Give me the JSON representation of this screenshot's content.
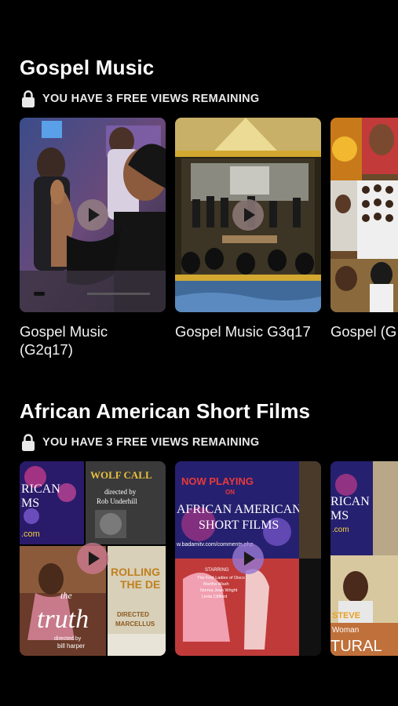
{
  "sections": [
    {
      "title": "Gospel Music",
      "views_notice": "YOU HAVE 3 FREE VIEWS REMAINING",
      "cards": [
        {
          "title_line1": "Gospel Music",
          "title_line2": "(G2q17)"
        },
        {
          "title_line1": "Gospel Music G3q17",
          "title_line2": ""
        },
        {
          "title_line1": "Gospel (G",
          "title_line2": ""
        }
      ]
    },
    {
      "title": "African American Short Films",
      "views_notice": "YOU HAVE 3 FREE VIEWS REMAINING",
      "cards": [
        {
          "poster_text": {
            "wolf_call": "WOLF CALL",
            "directed_by": "directed by",
            "director": "Rob Underhill",
            "rican": "RICAN",
            "ms": "MS",
            "com": ".com",
            "truth_the": "the",
            "truth": "truth",
            "directed_by_2": "directed by",
            "bill": "bill harper",
            "rolling": "ROLLING",
            "the_de": "THE DE",
            "directed": "DIRECTED",
            "marcellus": "MARCELLUS"
          }
        },
        {
          "poster_text": {
            "now_playing": "NOW PLAYING",
            "on": "ON",
            "line1": "AFRICAN AMERICAN",
            "line2": "SHORT FILMS",
            "url": "w.badamitv.com/comments.php",
            "starring": "STARRING",
            "cast1": "The First Ladies of Disco",
            "cast2": "Martha Wash",
            "cast3": "Norma Jean Wright",
            "cast4": "Linda Clifford"
          }
        },
        {
          "poster_text": {
            "rican": "RICAN",
            "ms": "MS",
            "com": ".com",
            "steve": "STEVE",
            "woman": "Woman",
            "tural": "TURAL"
          }
        }
      ]
    }
  ],
  "colors": {
    "background": "#000000",
    "text": "#ffffff",
    "notice": "#e9e9e9"
  },
  "icons": {
    "lock": "lock-icon",
    "play": "play-icon"
  }
}
